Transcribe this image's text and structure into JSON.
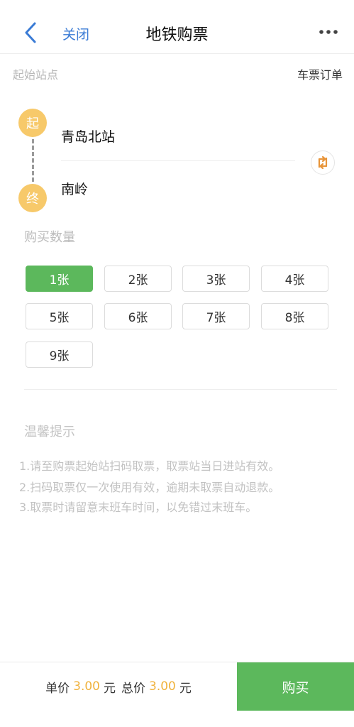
{
  "navbar": {
    "title": "地铁购票",
    "close_label": "关闭",
    "back_icon": "chevron-left-icon",
    "more_icon": "more-dots-icon"
  },
  "stations": {
    "section_label": "起始站点",
    "orders_link": "车票订单",
    "start_badge": "起",
    "end_badge": "终",
    "start_name": "青岛北站",
    "end_name": "南岭",
    "swap_icon": "swap-icon"
  },
  "quantity": {
    "label": "购买数量",
    "options": [
      "1张",
      "2张",
      "3张",
      "4张",
      "5张",
      "6张",
      "7张",
      "8张",
      "9张"
    ],
    "selected_index": 0
  },
  "tips": {
    "title": "温馨提示",
    "lines": [
      "1.请至购票起始站扫码取票，取票站当日进站有效。",
      "2.扫码取票仅一次使用有效，逾期未取票自动退款。",
      "3.取票时请留意末班车时间，以免错过末班车。"
    ]
  },
  "footer": {
    "unit_price_label": "单价",
    "unit_price": "3.00",
    "unit_currency": "元",
    "total_label": "总价",
    "total_price": "3.00",
    "total_currency": "元",
    "buy_label": "购买"
  },
  "colors": {
    "accent_green": "#5cb85c",
    "badge_yellow": "#f7c96a",
    "link_blue": "#3a7bd5",
    "swap_orange": "#e8953a",
    "price_yellow": "#f0b23c"
  }
}
